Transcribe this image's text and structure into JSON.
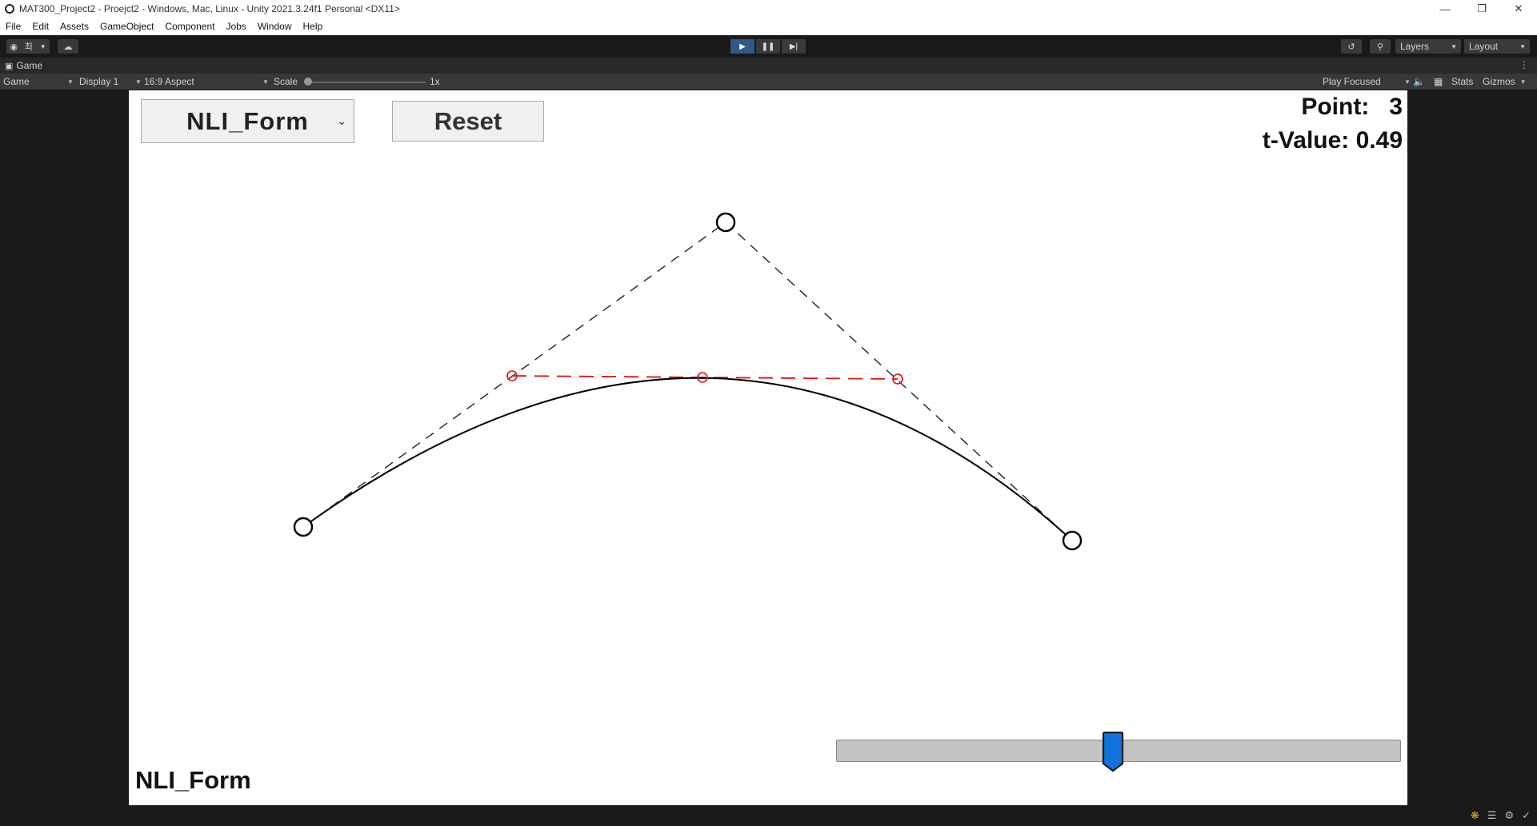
{
  "window": {
    "title": "MAT300_Project2 - Proejct2 - Windows, Mac, Linux - Unity 2021.3.24f1 Personal <DX11>",
    "controls": [
      "minimize-icon",
      "restore-icon",
      "close-icon"
    ]
  },
  "menu": {
    "items": [
      "File",
      "Edit",
      "Assets",
      "GameObject",
      "Component",
      "Jobs",
      "Window",
      "Help"
    ]
  },
  "toolbar": {
    "account_label": "최",
    "layers_label": "Layers",
    "layout_label": "Layout",
    "play_state": "playing",
    "accent_color": "#2f5a86"
  },
  "game_tab": {
    "label": "Game"
  },
  "game_controls": {
    "view_select": "Game",
    "display_select": "Display 1",
    "aspect_select": "16:9 Aspect",
    "scale_label": "Scale",
    "scale_value": "1x",
    "play_mode": "Play Focused",
    "stats_label": "Stats",
    "gizmos_label": "Gizmos"
  },
  "game": {
    "form_dropdown": "NLI_Form",
    "reset_button": "Reset",
    "point_label": "Point:   3",
    "t_value_label": "t-Value: 0.49",
    "form_label": "NLI_Form",
    "t_value": 0.49,
    "point_count": 3,
    "control_color": "#000000",
    "construction_color": "#e01010"
  }
}
